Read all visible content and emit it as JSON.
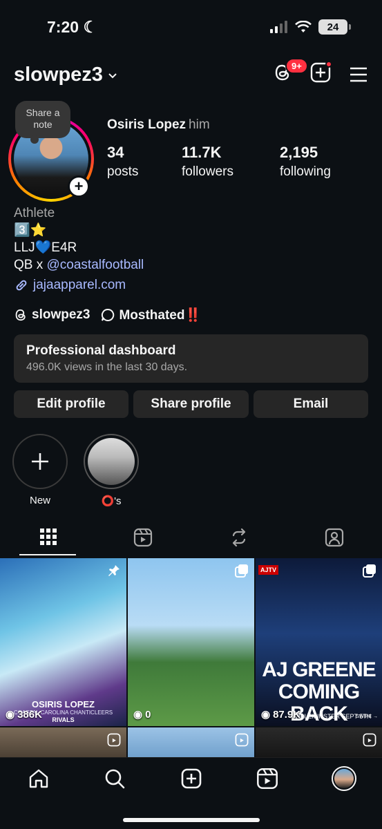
{
  "status_bar": {
    "time": "7:20",
    "battery": "24"
  },
  "header": {
    "username": "slowpez3",
    "threads_badge": "9+"
  },
  "profile": {
    "note_prompt": "Share a note",
    "display_name": "Osiris Lopez",
    "pronoun": "him",
    "stats": [
      {
        "value": "34",
        "label": "posts"
      },
      {
        "value": "11.7K",
        "label": "followers"
      },
      {
        "value": "2,195",
        "label": "following"
      }
    ],
    "bio": {
      "category": "Athlete",
      "line1": "3️⃣⭐️",
      "line2": "LLJ💙E4R",
      "line3_prefix": "QB x ",
      "line3_mention": "@coastalfootball",
      "link": "jajaapparel.com"
    },
    "threads_handle": "slowpez3",
    "status_note": "Mosthated‼️"
  },
  "dashboard": {
    "title": "Professional dashboard",
    "subtitle": "496.0K views in the last 30 days."
  },
  "actions": {
    "edit": "Edit profile",
    "share": "Share profile",
    "email": "Email"
  },
  "highlights": [
    {
      "label": "New"
    },
    {
      "label": "⭕️'s"
    }
  ],
  "grid": [
    {
      "views": "386K",
      "caption": "OSIRIS LOPEZ",
      "subcaption": "COASTAL CAROLINA CHANTICLEERS",
      "brand": "RIVALS"
    },
    {
      "views": "0"
    },
    {
      "views": "87.9K",
      "headline_1": "AJ GREENE",
      "headline_2": "COMING BACK",
      "footer": "VS LEMINSTER SEPT 5TH",
      "swipe": "SWIPE →",
      "logo_text": "AJTV"
    }
  ],
  "colors": {
    "background": "#0c1014",
    "button": "#262626",
    "link": "#a8b9ff",
    "badge": "#ff3040"
  }
}
